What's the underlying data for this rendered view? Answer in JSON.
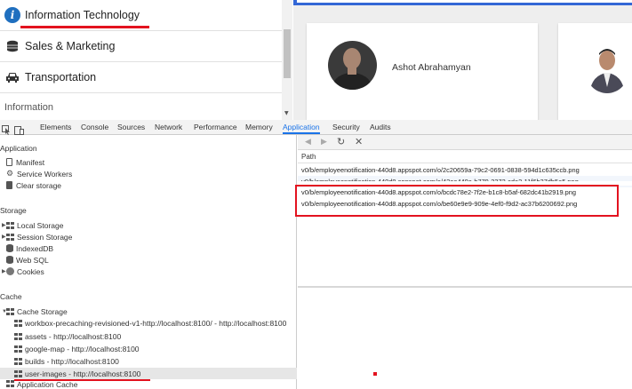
{
  "categories": {
    "items": [
      {
        "label": "Information Technology",
        "icon": "info-icon"
      },
      {
        "label": "Sales & Marketing",
        "icon": "coins-icon"
      },
      {
        "label": "Transportation",
        "icon": "car-icon"
      }
    ],
    "section_label": "Information"
  },
  "employee": {
    "name": "Ashot Abrahamyan"
  },
  "devtools": {
    "tabs": [
      "Elements",
      "Console",
      "Sources",
      "Network",
      "Performance",
      "Memory",
      "Application",
      "Security",
      "Audits"
    ],
    "active_tab": "Application",
    "sidebar": {
      "application_head": "Application",
      "application_items": [
        "Manifest",
        "Service Workers",
        "Clear storage"
      ],
      "storage_head": "Storage",
      "storage_items": [
        "Local Storage",
        "Session Storage",
        "IndexedDB",
        "Web SQL",
        "Cookies"
      ],
      "cache_head": "Cache",
      "cache_storage": "Cache Storage",
      "cache_items": [
        "workbox-precaching-revisioned-v1-http://localhost:8100/ - http://localhost:8100",
        "assets - http://localhost:8100",
        "google-map - http://localhost:8100",
        "builds - http://localhost:8100",
        "user-images - http://localhost:8100"
      ],
      "app_cache": "Application Cache"
    },
    "column_header": "Path",
    "rows": [
      "v0/b/employeenotification-440d8.appspot.com/o/2c20659a-79c2-0691-0838-594d1c635ccb.png",
      "v0/b/employeenotification-440d8.appspot.com/o/42ea440e-b779-2372-cde2-11f6b37db5a5.png",
      "v0/b/employeenotification-440d8.appspot.com/o/bcdc78e2-7f2e-b1c8-b5af-682dc41b2919.png",
      "v0/b/employeenotification-440d8.appspot.com/o/be60e9e9-909e-4ef0-f9d2-ac37b6200692.png"
    ]
  },
  "colors": {
    "accent": "#1a73e8",
    "highlight": "#e3121f",
    "info_icon": "#1f6fbf"
  }
}
